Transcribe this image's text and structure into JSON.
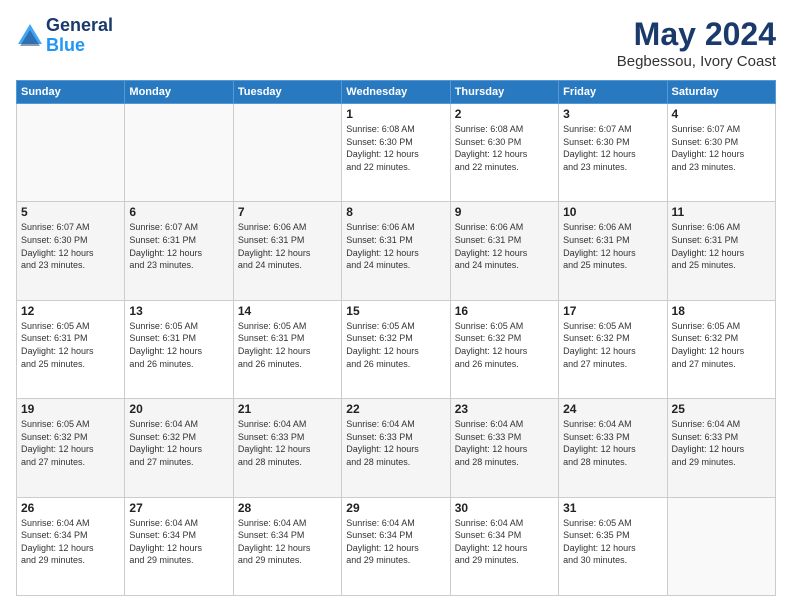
{
  "header": {
    "logo_line1": "General",
    "logo_line2": "Blue",
    "month_year": "May 2024",
    "location": "Begbessou, Ivory Coast"
  },
  "days_of_week": [
    "Sunday",
    "Monday",
    "Tuesday",
    "Wednesday",
    "Thursday",
    "Friday",
    "Saturday"
  ],
  "weeks": [
    [
      {
        "day": "",
        "info": ""
      },
      {
        "day": "",
        "info": ""
      },
      {
        "day": "",
        "info": ""
      },
      {
        "day": "1",
        "info": "Sunrise: 6:08 AM\nSunset: 6:30 PM\nDaylight: 12 hours\nand 22 minutes."
      },
      {
        "day": "2",
        "info": "Sunrise: 6:08 AM\nSunset: 6:30 PM\nDaylight: 12 hours\nand 22 minutes."
      },
      {
        "day": "3",
        "info": "Sunrise: 6:07 AM\nSunset: 6:30 PM\nDaylight: 12 hours\nand 23 minutes."
      },
      {
        "day": "4",
        "info": "Sunrise: 6:07 AM\nSunset: 6:30 PM\nDaylight: 12 hours\nand 23 minutes."
      }
    ],
    [
      {
        "day": "5",
        "info": "Sunrise: 6:07 AM\nSunset: 6:30 PM\nDaylight: 12 hours\nand 23 minutes."
      },
      {
        "day": "6",
        "info": "Sunrise: 6:07 AM\nSunset: 6:31 PM\nDaylight: 12 hours\nand 23 minutes."
      },
      {
        "day": "7",
        "info": "Sunrise: 6:06 AM\nSunset: 6:31 PM\nDaylight: 12 hours\nand 24 minutes."
      },
      {
        "day": "8",
        "info": "Sunrise: 6:06 AM\nSunset: 6:31 PM\nDaylight: 12 hours\nand 24 minutes."
      },
      {
        "day": "9",
        "info": "Sunrise: 6:06 AM\nSunset: 6:31 PM\nDaylight: 12 hours\nand 24 minutes."
      },
      {
        "day": "10",
        "info": "Sunrise: 6:06 AM\nSunset: 6:31 PM\nDaylight: 12 hours\nand 25 minutes."
      },
      {
        "day": "11",
        "info": "Sunrise: 6:06 AM\nSunset: 6:31 PM\nDaylight: 12 hours\nand 25 minutes."
      }
    ],
    [
      {
        "day": "12",
        "info": "Sunrise: 6:05 AM\nSunset: 6:31 PM\nDaylight: 12 hours\nand 25 minutes."
      },
      {
        "day": "13",
        "info": "Sunrise: 6:05 AM\nSunset: 6:31 PM\nDaylight: 12 hours\nand 26 minutes."
      },
      {
        "day": "14",
        "info": "Sunrise: 6:05 AM\nSunset: 6:31 PM\nDaylight: 12 hours\nand 26 minutes."
      },
      {
        "day": "15",
        "info": "Sunrise: 6:05 AM\nSunset: 6:32 PM\nDaylight: 12 hours\nand 26 minutes."
      },
      {
        "day": "16",
        "info": "Sunrise: 6:05 AM\nSunset: 6:32 PM\nDaylight: 12 hours\nand 26 minutes."
      },
      {
        "day": "17",
        "info": "Sunrise: 6:05 AM\nSunset: 6:32 PM\nDaylight: 12 hours\nand 27 minutes."
      },
      {
        "day": "18",
        "info": "Sunrise: 6:05 AM\nSunset: 6:32 PM\nDaylight: 12 hours\nand 27 minutes."
      }
    ],
    [
      {
        "day": "19",
        "info": "Sunrise: 6:05 AM\nSunset: 6:32 PM\nDaylight: 12 hours\nand 27 minutes."
      },
      {
        "day": "20",
        "info": "Sunrise: 6:04 AM\nSunset: 6:32 PM\nDaylight: 12 hours\nand 27 minutes."
      },
      {
        "day": "21",
        "info": "Sunrise: 6:04 AM\nSunset: 6:33 PM\nDaylight: 12 hours\nand 28 minutes."
      },
      {
        "day": "22",
        "info": "Sunrise: 6:04 AM\nSunset: 6:33 PM\nDaylight: 12 hours\nand 28 minutes."
      },
      {
        "day": "23",
        "info": "Sunrise: 6:04 AM\nSunset: 6:33 PM\nDaylight: 12 hours\nand 28 minutes."
      },
      {
        "day": "24",
        "info": "Sunrise: 6:04 AM\nSunset: 6:33 PM\nDaylight: 12 hours\nand 28 minutes."
      },
      {
        "day": "25",
        "info": "Sunrise: 6:04 AM\nSunset: 6:33 PM\nDaylight: 12 hours\nand 29 minutes."
      }
    ],
    [
      {
        "day": "26",
        "info": "Sunrise: 6:04 AM\nSunset: 6:34 PM\nDaylight: 12 hours\nand 29 minutes."
      },
      {
        "day": "27",
        "info": "Sunrise: 6:04 AM\nSunset: 6:34 PM\nDaylight: 12 hours\nand 29 minutes."
      },
      {
        "day": "28",
        "info": "Sunrise: 6:04 AM\nSunset: 6:34 PM\nDaylight: 12 hours\nand 29 minutes."
      },
      {
        "day": "29",
        "info": "Sunrise: 6:04 AM\nSunset: 6:34 PM\nDaylight: 12 hours\nand 29 minutes."
      },
      {
        "day": "30",
        "info": "Sunrise: 6:04 AM\nSunset: 6:34 PM\nDaylight: 12 hours\nand 29 minutes."
      },
      {
        "day": "31",
        "info": "Sunrise: 6:05 AM\nSunset: 6:35 PM\nDaylight: 12 hours\nand 30 minutes."
      },
      {
        "day": "",
        "info": ""
      }
    ]
  ]
}
